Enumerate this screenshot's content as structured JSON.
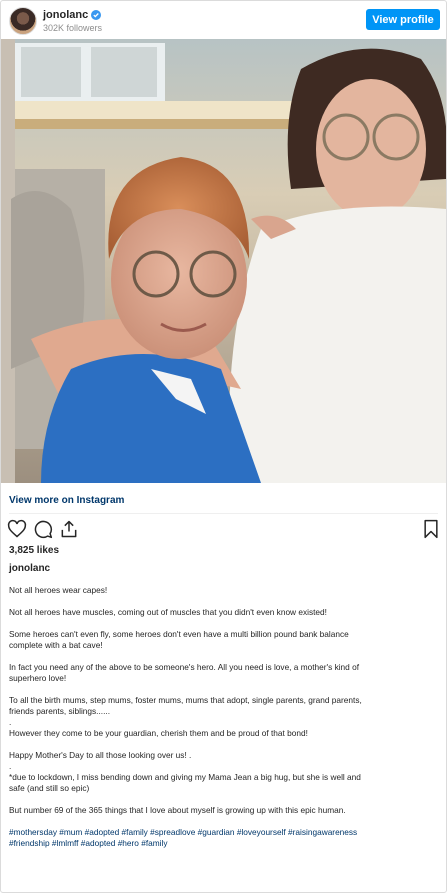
{
  "header": {
    "username": "jonolanc",
    "followers": "302K followers",
    "view_profile_label": "View profile"
  },
  "post": {
    "view_more_label": "View more on Instagram",
    "likes": "3,825 likes",
    "author": "jonolanc",
    "caption": [
      "Not all heroes wear capes!",
      "",
      "Not all heroes have muscles, coming out of muscles that you didn't even know existed!",
      "",
      "Some heroes can't even fly, some heroes don't even have a multi billion pound bank balance",
      "complete with a bat cave!",
      "",
      "In fact you need any of the above to be someone's hero. All you need is love, a mother's kind of",
      "superhero love!",
      "",
      "To all the birth mums, step mums, foster mums, mums that adopt, single parents, grand parents,",
      "friends parents, siblings......",
      ".",
      "However they come to be your guardian, cherish them and be proud of that bond!",
      "",
      "Happy Mother's Day to all those looking over us! .",
      ".",
      "*due to lockdown, I miss bending down and giving my Mama Jean a big hug, but she is well and",
      "safe (and still so epic)",
      "",
      "But number 69 of the 365 things that I love about myself is growing up with this epic human."
    ],
    "hashtags": [
      "#mothersday #mum #adopted #family #spreadlove #guardian #loveyourself #raisingawareness",
      "#friendship #lmlmff #adopted #hero #family"
    ]
  },
  "colors": {
    "accent": "#0095f6",
    "link": "#00376b",
    "muted": "#8e8e8e"
  },
  "icons": [
    "verified-badge-icon",
    "heart-icon",
    "comment-icon",
    "share-icon",
    "bookmark-icon"
  ]
}
